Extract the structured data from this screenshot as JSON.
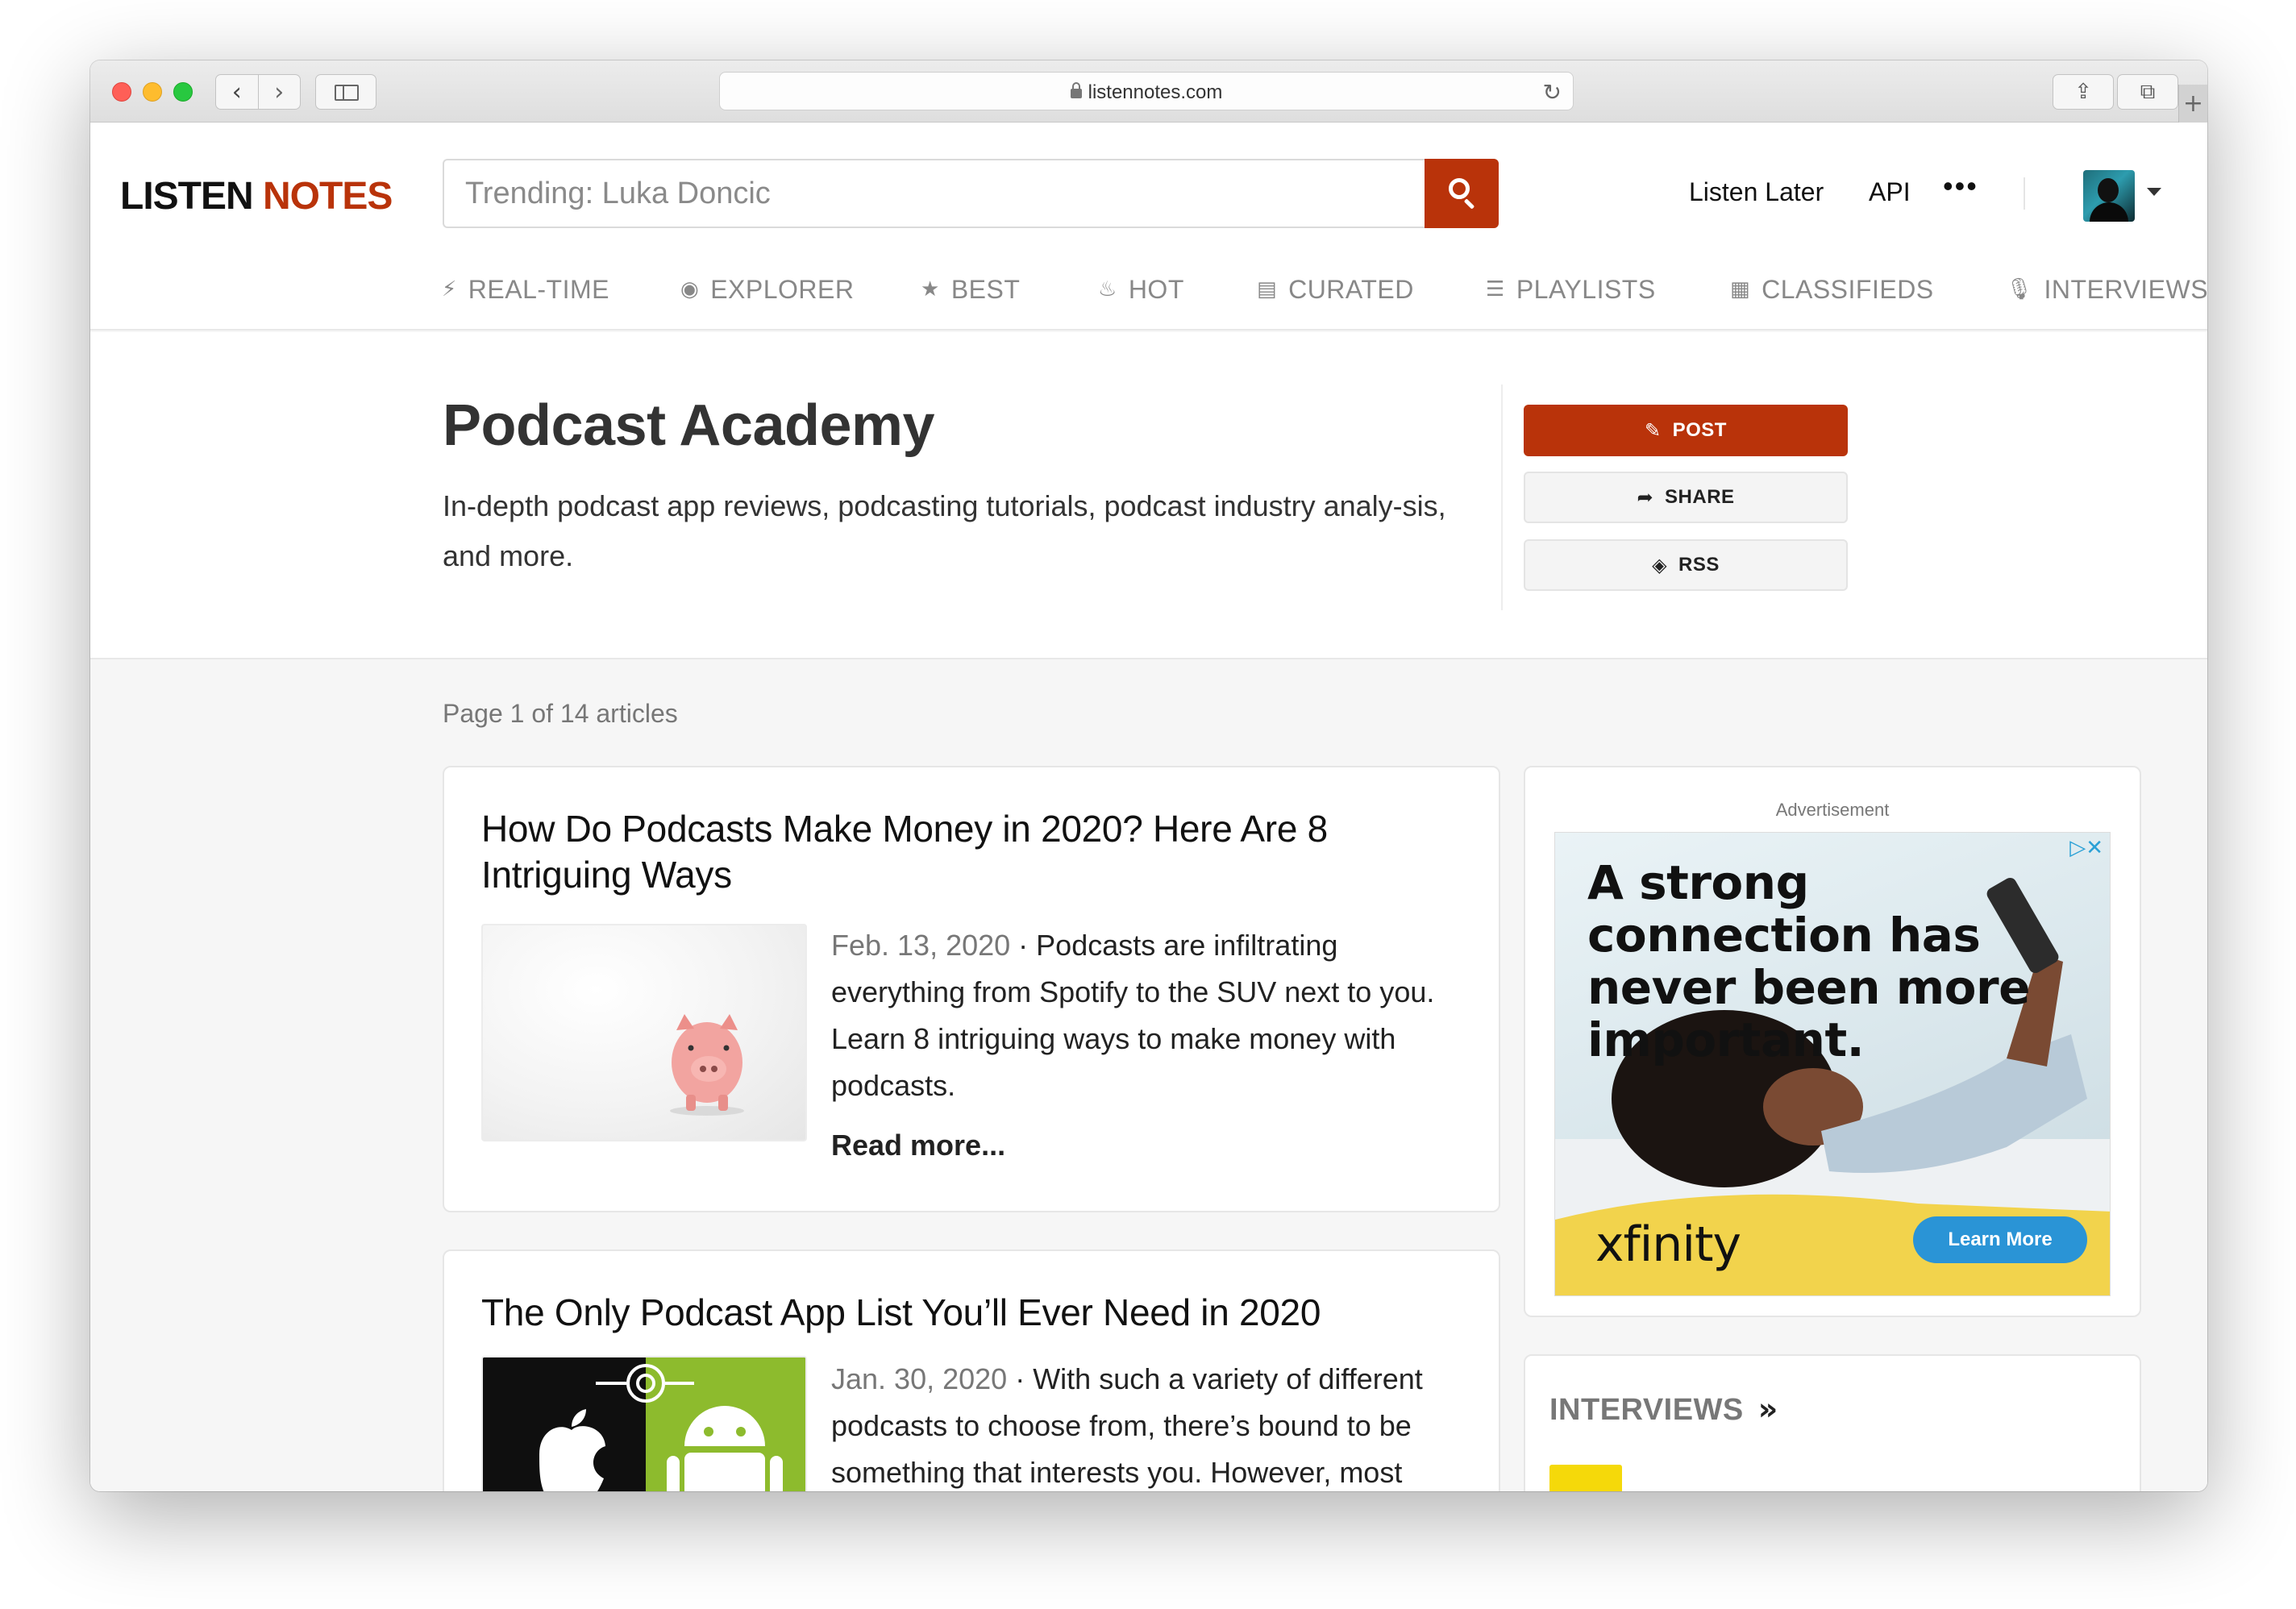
{
  "browser": {
    "url": "listennotes.com",
    "back_icon": "‹",
    "forward_icon": "›",
    "reload_icon": "↻",
    "share_icon": "⇪",
    "tabs_icon": "⧉",
    "newtab_icon": "+"
  },
  "header": {
    "logo_part1": "LISTEN",
    "logo_part2": "NOTES",
    "search_placeholder": "Trending: Luka Doncic",
    "listen_later": "Listen Later",
    "api": "API",
    "more": "•••"
  },
  "categories": [
    {
      "icon": "bolt-icon",
      "glyph": "⚡",
      "label": "REAL-TIME"
    },
    {
      "icon": "compass-icon",
      "glyph": "◉",
      "label": "EXPLORER"
    },
    {
      "icon": "star-icon",
      "glyph": "★",
      "label": "BEST"
    },
    {
      "icon": "flame-icon",
      "glyph": "♨",
      "label": "HOT"
    },
    {
      "icon": "book-icon",
      "glyph": "▤",
      "label": "CURATED"
    },
    {
      "icon": "list-icon",
      "glyph": "☰",
      "label": "PLAYLISTS"
    },
    {
      "icon": "newspaper-icon",
      "glyph": "▦",
      "label": "CLASSIFIEDS"
    },
    {
      "icon": "microphone-icon",
      "glyph": "🎙",
      "label": "INTERVIEWS"
    }
  ],
  "hero": {
    "title": "Podcast Academy",
    "description": "In-depth podcast app reviews, podcasting tutorials, podcast industry analy-sis, and more.",
    "post": "POST",
    "share": "SHARE",
    "rss": "RSS",
    "post_icon": "✎",
    "share_icon": "➦",
    "rss_icon": "◈"
  },
  "listing": {
    "page_count": "Page 1 of 14 articles"
  },
  "articles": [
    {
      "title": "How Do Podcasts Make Money in 2020? Here Are 8 Intriguing Ways",
      "date": "Feb. 13, 2020",
      "separator": " · ",
      "excerpt": "Podcasts are infiltrating everything from Spotify to the SUV next to you. Learn 8 intriguing ways to make money with podcasts.",
      "read_more": "Read more..."
    },
    {
      "title": "The Only Podcast App List You’ll Ever Need in 2020",
      "date": "Jan. 30, 2020",
      "separator": " · ",
      "excerpt": "With such a variety of different podcasts to choose from, there’s bound to be something that interests you. However, most"
    }
  ],
  "ad": {
    "label": "Advertisement",
    "headline": "A strong connection has never been more important.",
    "brand": "xfinity",
    "cta": "Learn More",
    "choices": "▷✕"
  },
  "interviews": {
    "title": "INTERVIEWS",
    "arrow": "»"
  },
  "colors": {
    "brand_red": "#b9330a",
    "ad_blue": "#2a94d6"
  }
}
